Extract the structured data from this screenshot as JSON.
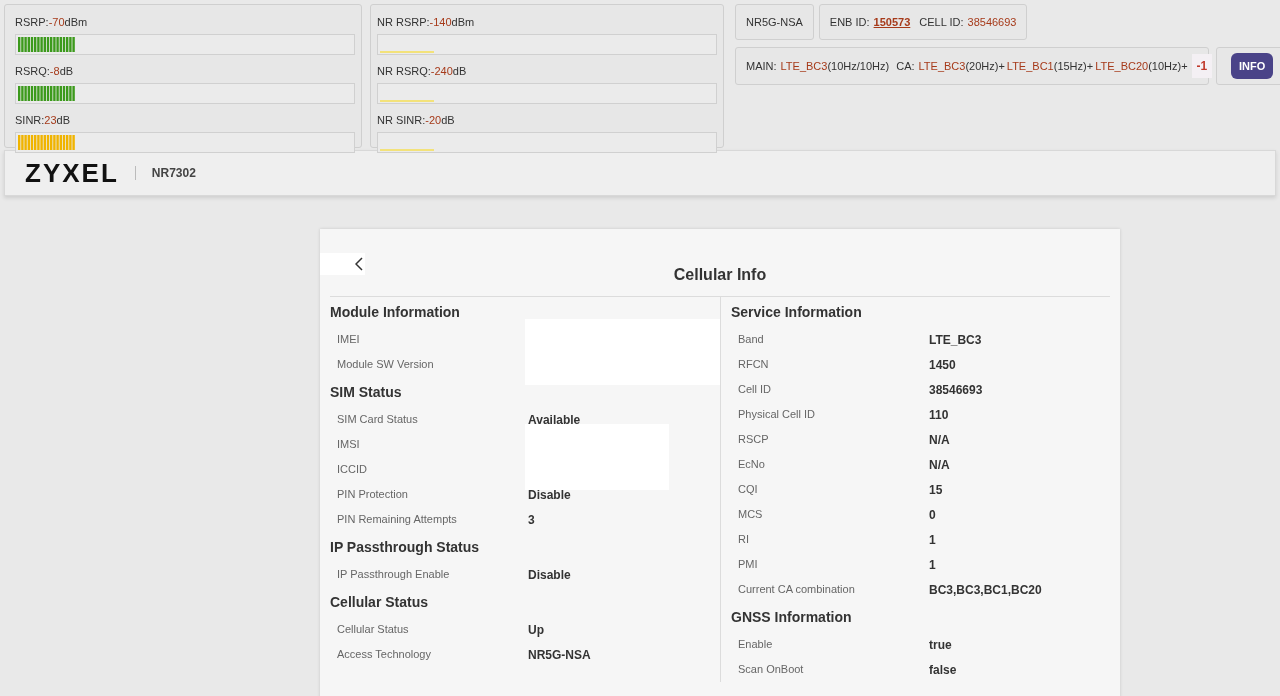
{
  "meters": [
    {
      "label": "RSRP:",
      "value": "-70",
      "unit": "dBm",
      "level": 0.17,
      "color": "#3c9a1c",
      "kind": "bars"
    },
    {
      "label": "RSRQ:",
      "value": "-8",
      "unit": "dB",
      "level": 0.17,
      "color": "#3c9a1c",
      "kind": "bars"
    },
    {
      "label": "SINR:",
      "value": "23",
      "unit": "dB",
      "level": 0.17,
      "color": "#f0b400",
      "kind": "bars"
    }
  ],
  "nr_meters": [
    {
      "label": "NR RSRP:",
      "value": "-140",
      "unit": "dBm",
      "level": 0.16,
      "color": "#f3e27a",
      "kind": "line"
    },
    {
      "label": "NR RSRQ:",
      "value": "-240",
      "unit": "dB",
      "level": 0.16,
      "color": "#f3e27a",
      "kind": "line"
    },
    {
      "label": "NR SINR:",
      "value": "-20",
      "unit": "dB",
      "level": 0.16,
      "color": "#f3e27a",
      "kind": "line"
    }
  ],
  "network_mode": "NR5G-NSA",
  "enb": {
    "label": "ENB ID:",
    "value": "150573",
    "cell_label": "CELL ID:",
    "cell_value": "38546693"
  },
  "carriers": {
    "main_label": "MAIN:",
    "main": [
      {
        "band": "LTE_BC3",
        "width": "(10Hz/10Hz)"
      }
    ],
    "ca_label": "CA:",
    "ca": [
      {
        "band": "LTE_BC3",
        "width": "(20Hz)+"
      },
      {
        "band": "LTE_BC1",
        "width": "(15Hz)+"
      },
      {
        "band": "LTE_BC20",
        "width": "(10Hz)+"
      }
    ],
    "badge": "-1"
  },
  "info_button": "INFO",
  "brand": {
    "logo": "ZYXEL",
    "model": "NR7302"
  },
  "card": {
    "title": "Cellular Info",
    "left": [
      {
        "heading": "Module Information",
        "rows": [
          {
            "label": "IMEI",
            "redacted": true
          },
          {
            "label": "Module SW Version",
            "redacted": true
          }
        ]
      },
      {
        "heading": "SIM Status",
        "rows": [
          {
            "label": "SIM Card Status",
            "value": "Available"
          },
          {
            "label": "IMSI",
            "redacted": true
          },
          {
            "label": "ICCID",
            "redacted": true
          },
          {
            "label": "PIN Protection",
            "value": "Disable"
          },
          {
            "label": "PIN Remaining Attempts",
            "value": "3"
          }
        ]
      },
      {
        "heading": "IP Passthrough Status",
        "rows": [
          {
            "label": "IP Passthrough Enable",
            "value": "Disable"
          }
        ]
      },
      {
        "heading": "Cellular Status",
        "rows": [
          {
            "label": "Cellular Status",
            "value": "Up"
          },
          {
            "label": "Access Technology",
            "value": "NR5G-NSA"
          }
        ]
      }
    ],
    "right": [
      {
        "heading": "Service Information",
        "rows": [
          {
            "label": "Band",
            "value": "LTE_BC3"
          },
          {
            "label": "RFCN",
            "value": "1450"
          },
          {
            "label": "Cell ID",
            "value": "38546693"
          },
          {
            "label": "Physical Cell ID",
            "value": "110"
          },
          {
            "label": "RSCP",
            "value": "N/A"
          },
          {
            "label": "EcNo",
            "value": "N/A"
          },
          {
            "label": "CQI",
            "value": "15"
          },
          {
            "label": "MCS",
            "value": "0"
          },
          {
            "label": "RI",
            "value": "1"
          },
          {
            "label": "PMI",
            "value": "1"
          },
          {
            "label": "Current CA combination",
            "value": "BC3,BC3,BC1,BC20"
          }
        ]
      },
      {
        "heading": "GNSS Information",
        "rows": [
          {
            "label": "Enable",
            "value": "true"
          },
          {
            "label": "Scan OnBoot",
            "value": "false"
          }
        ]
      }
    ]
  }
}
